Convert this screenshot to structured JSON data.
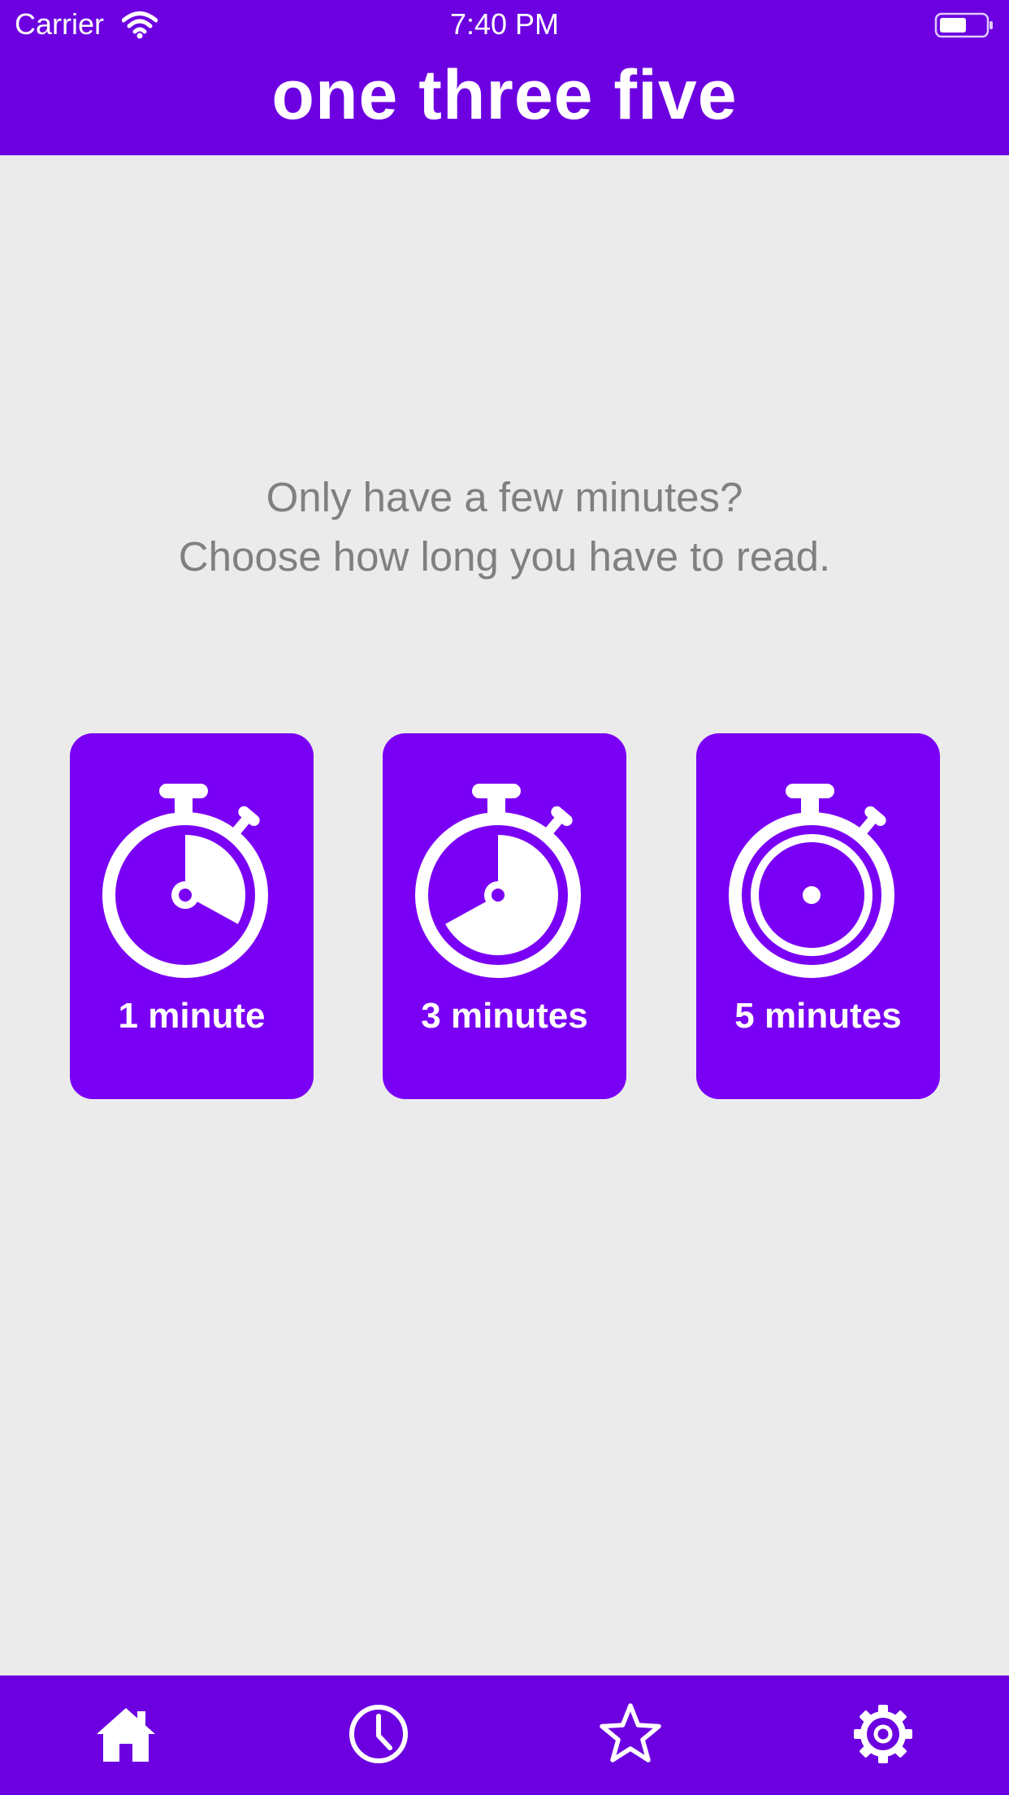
{
  "status_bar": {
    "carrier": "Carrier",
    "time": "7:40 PM",
    "icons": [
      "wifi-icon",
      "battery-icon"
    ]
  },
  "header": {
    "title": "one three five"
  },
  "prompt": {
    "line1": "Only have a few minutes?",
    "line2": "Choose how long you have to read."
  },
  "options": [
    {
      "label": "1 minute",
      "icon": "stopwatch-icon",
      "elapsed_fraction": 0.33
    },
    {
      "label": "3 minutes",
      "icon": "stopwatch-icon",
      "elapsed_fraction": 0.67
    },
    {
      "label": "5 minutes",
      "icon": "stopwatch-icon",
      "elapsed_fraction": 0.0
    }
  ],
  "tab_bar": {
    "tabs": [
      {
        "name": "home",
        "icon": "home-icon"
      },
      {
        "name": "history",
        "icon": "clock-icon"
      },
      {
        "name": "favorites",
        "icon": "star-icon"
      },
      {
        "name": "settings",
        "icon": "gear-icon"
      }
    ]
  },
  "colors": {
    "header": "#6c00e0",
    "card": "#7a00f5",
    "background": "#ebebeb",
    "prompt_text": "#808080",
    "icon": "#ffffff"
  }
}
